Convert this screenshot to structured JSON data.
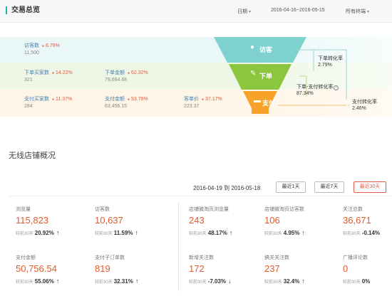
{
  "header": {
    "title": "交易总览",
    "date_label": "日期",
    "date_value": "2016-04-16~2016-05-15",
    "terminal_label": "所有终端"
  },
  "funnel": {
    "stage_visit": {
      "label": "访客",
      "icon": "user-icon"
    },
    "stage_order": {
      "label": "下单",
      "icon": "hammer-icon"
    },
    "stage_pay": {
      "label": "支付",
      "icon": "card-icon"
    },
    "rate_order": {
      "label": "下单转化率",
      "value": "2.79%"
    },
    "rate_pay_order": {
      "label": "下单-支付转化率",
      "value": "87.34%"
    },
    "rate_pay": {
      "label": "支付转化率",
      "value": "2.46%"
    },
    "colors": {
      "visit": "#7fd1cf",
      "order": "#8cc63f",
      "pay": "#f7a32a"
    }
  },
  "rows": {
    "visit": [
      {
        "label": "访客数",
        "pct": "6.76%",
        "value": "11,500"
      }
    ],
    "order": [
      {
        "label": "下单买家数",
        "pct": "14.22%",
        "value": "321"
      },
      {
        "label": "下单金额",
        "pct": "62.32%",
        "value": "79,664.66"
      }
    ],
    "pay": [
      {
        "label": "支付买家数",
        "pct": "11.37%",
        "value": "284"
      },
      {
        "label": "支付金额",
        "pct": "53.76%",
        "value": "63,456.15"
      },
      {
        "label": "客单价",
        "pct": "37.17%",
        "value": "223.37"
      }
    ]
  },
  "wireless": {
    "title": "无线店铺概况",
    "date_range": "2016-04-19 到 2016-05-18",
    "buttons": [
      "最近1天",
      "最近7天",
      "最近30天"
    ],
    "active_button": "最近30天"
  },
  "stats": [
    {
      "label": "浏览量",
      "value": "115,823",
      "cmp": "较前30天",
      "pct": "20.92%",
      "arrow": "↑"
    },
    {
      "label": "访客数",
      "value": "10,637",
      "cmp": "较前30天",
      "pct": "11.59%",
      "arrow": "↑"
    },
    {
      "label": "店铺微淘页浏览量",
      "value": "243",
      "cmp": "较前30天",
      "pct": "48.17%",
      "arrow": "↑"
    },
    {
      "label": "店铺微淘页访客数",
      "value": "106",
      "cmp": "较前30天",
      "pct": "4.95%",
      "arrow": "↑"
    },
    {
      "label": "关注总数",
      "value": "36,671",
      "cmp": "较前30天",
      "pct": "-0.14%",
      "arrow": ""
    },
    {
      "label": "支付金额",
      "value": "50,756.54",
      "cmp": "较前30天",
      "pct": "55.06%",
      "arrow": "↑"
    },
    {
      "label": "支付子订单数",
      "value": "819",
      "cmp": "较前30天",
      "pct": "32.31%",
      "arrow": "↑"
    },
    {
      "label": "新增关注数",
      "value": "172",
      "cmp": "较前30天",
      "pct": "-7.03%",
      "arrow": "↓"
    },
    {
      "label": "搞关关注数",
      "value": "237",
      "cmp": "较前30天",
      "pct": "32.4%",
      "arrow": "↑"
    },
    {
      "label": "广播评论数",
      "value": "0",
      "cmp": "较前30天",
      "pct": "0%",
      "arrow": ""
    }
  ]
}
